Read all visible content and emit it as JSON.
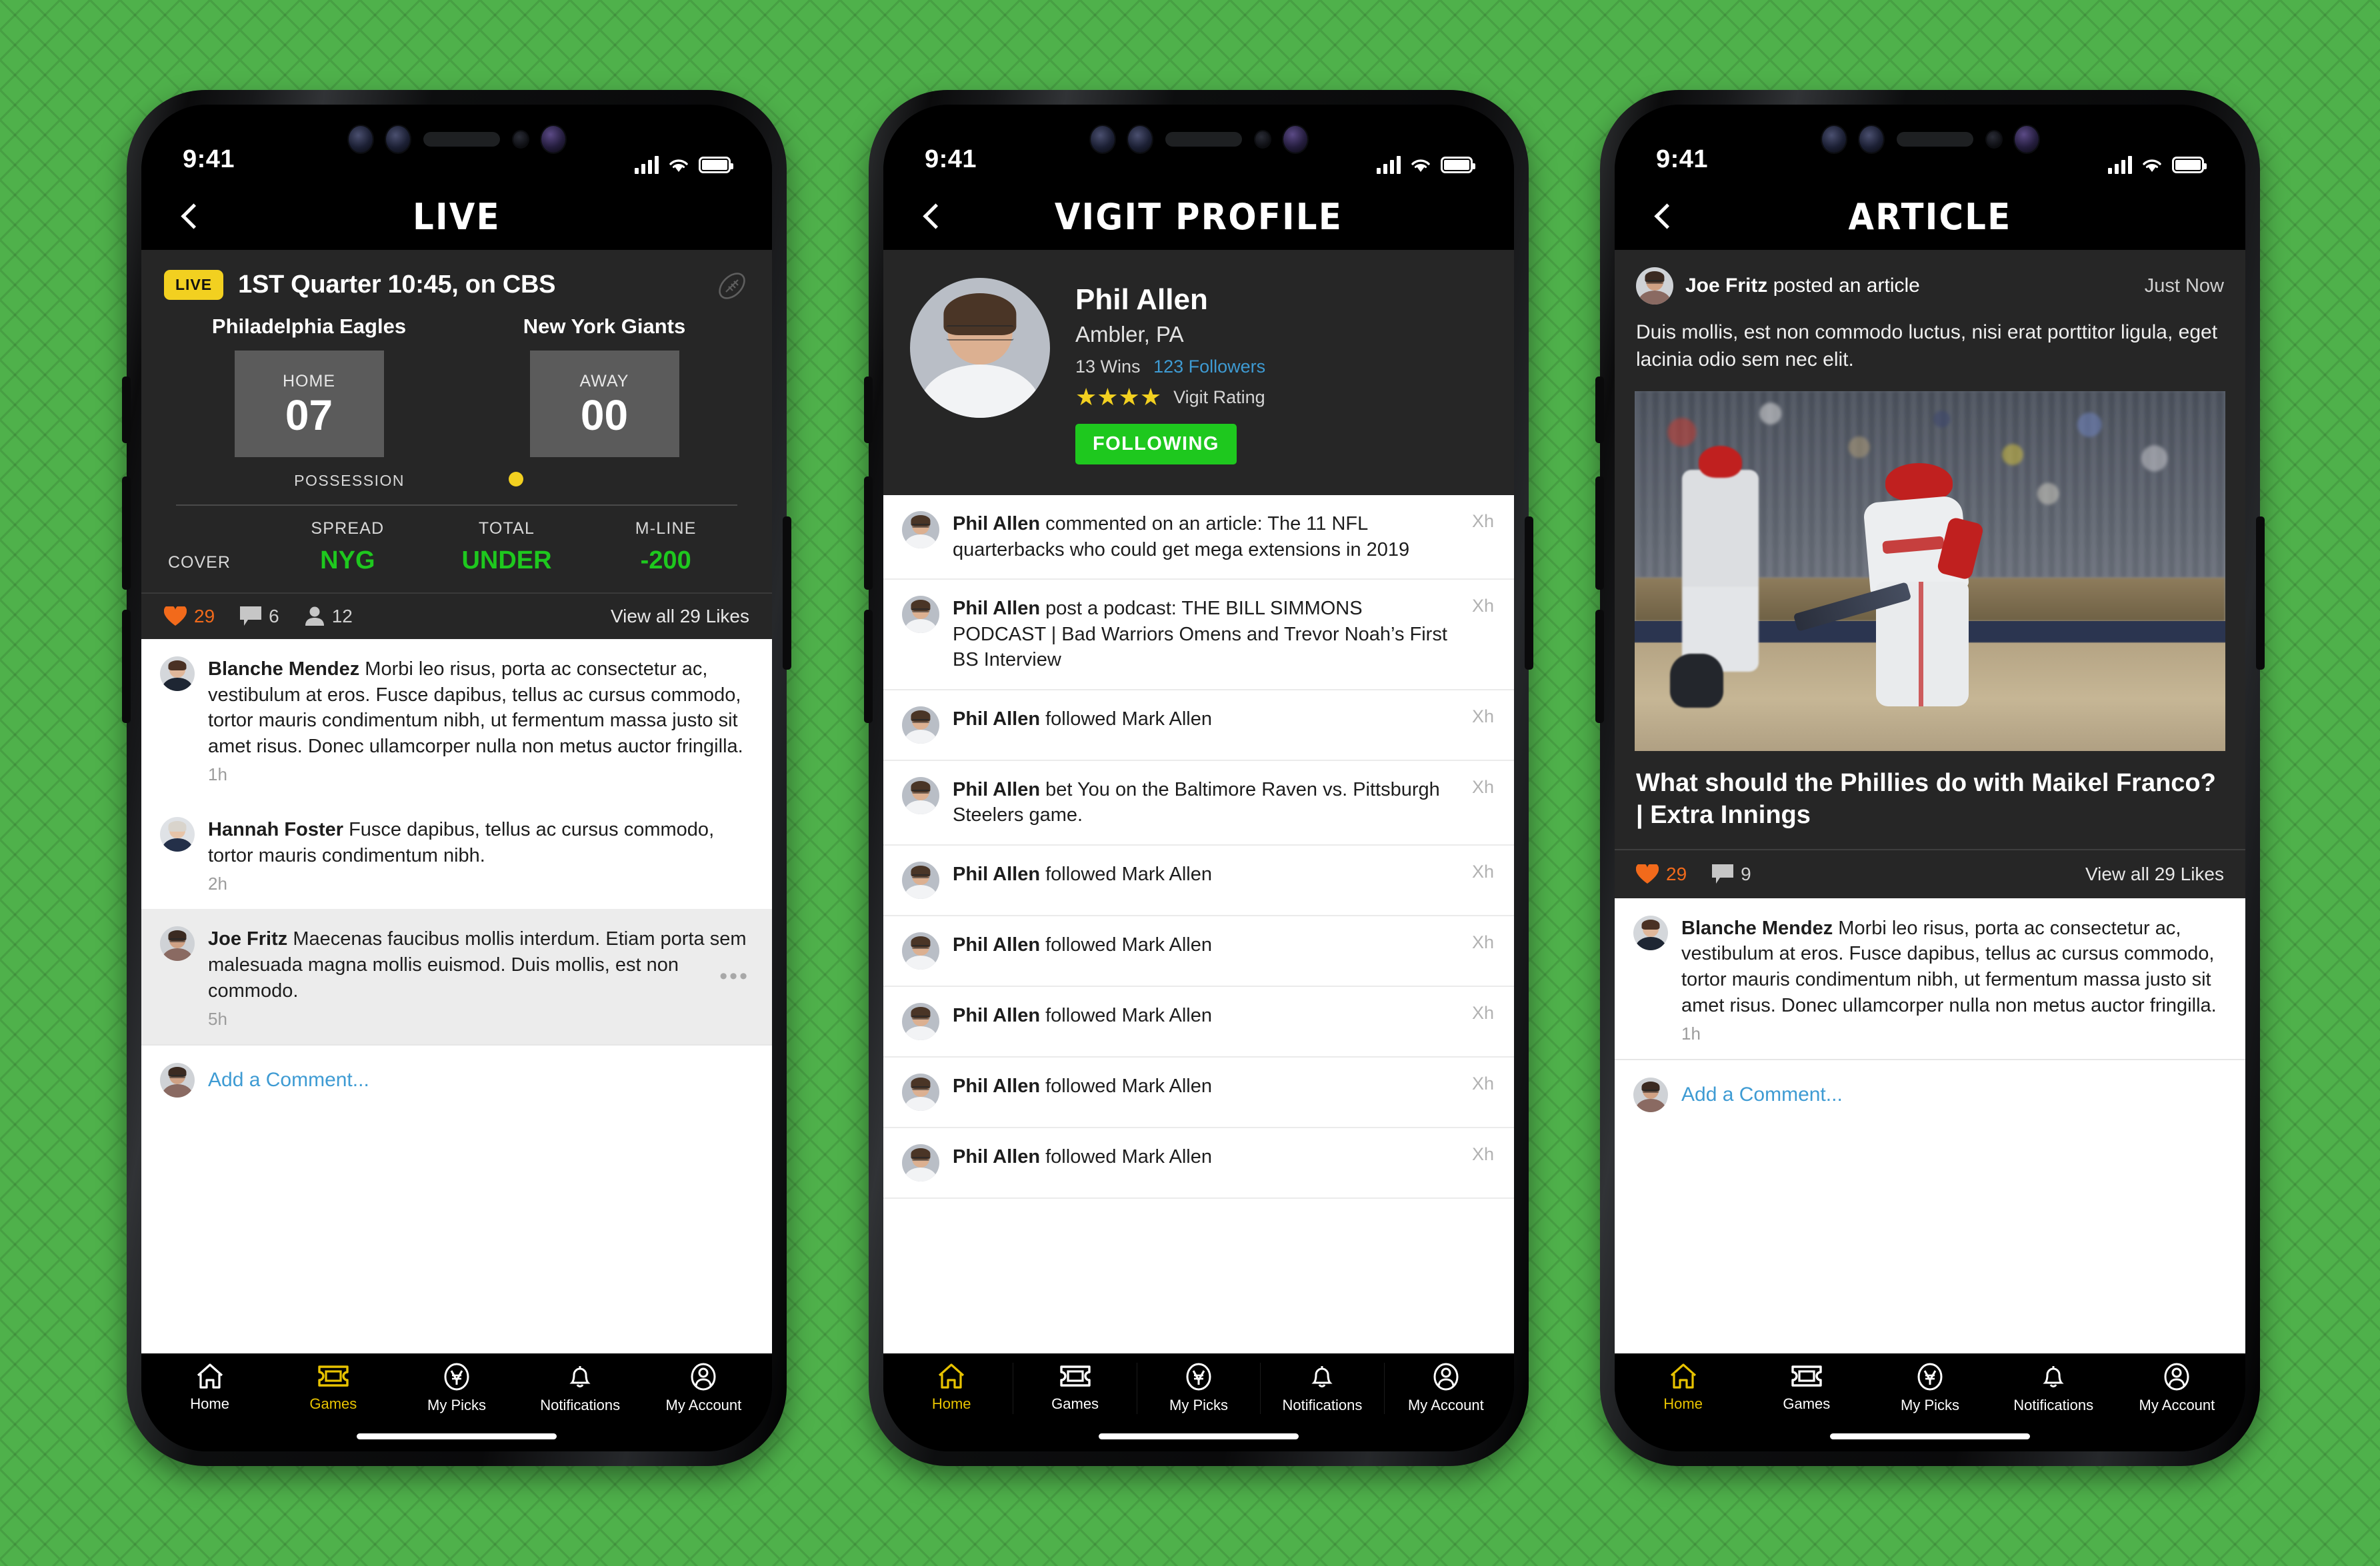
{
  "background": {
    "color": "#4fb14b",
    "pattern": "x-cross-tile"
  },
  "status_bar": {
    "time": "9:41",
    "signal_icon": "cellular-bars-icon",
    "wifi_icon": "wifi-icon",
    "battery_icon": "battery-icon"
  },
  "colors": {
    "accent_yellow": "#f2d020",
    "accent_green": "#1ec81e",
    "accent_orange": "#f26a1b",
    "link_blue": "#3e9bd3",
    "tab_active": "#e8c300",
    "panel_dark": "#262626"
  },
  "tabs": [
    {
      "label": "Home",
      "icon": "home-icon"
    },
    {
      "label": "Games",
      "icon": "ticket-icon"
    },
    {
      "label": "My Picks",
      "icon": "currency-oval-icon"
    },
    {
      "label": "Notifications",
      "icon": "bell-icon"
    },
    {
      "label": "My Account",
      "icon": "account-circle-icon"
    }
  ],
  "phone1": {
    "nav_title": "LIVE",
    "back_icon": "chevron-left-icon",
    "scoreboard": {
      "live_badge": "LIVE",
      "status_text": "1ST Quarter 10:45, on CBS",
      "sport_icon": "football-icon",
      "home": {
        "team": "Philadelphia Eagles",
        "side": "HOME",
        "score": "07"
      },
      "away": {
        "team": "New York Giants",
        "side": "AWAY",
        "score": "00"
      },
      "possession_label": "POSSESSION",
      "possession_team": "away",
      "odds": {
        "cover_label": "COVER",
        "columns": [
          {
            "label": "SPREAD",
            "value": "NYG"
          },
          {
            "label": "TOTAL",
            "value": "UNDER"
          },
          {
            "label": "M-LINE",
            "value": "-200"
          }
        ]
      }
    },
    "engagement": {
      "likes": "29",
      "comments": "6",
      "people": "12",
      "view_all": "View all 29 Likes",
      "like_icon": "heart-icon",
      "comment_icon": "speech-bubble-icon",
      "people_icon": "person-icon"
    },
    "comments": [
      {
        "author": "Blanche Mendez",
        "text": "Morbi leo risus, porta ac consectetur ac, vestibulum at eros. Fusce dapibus, tellus ac cursus commodo, tortor mauris condimentum nibh, ut fermentum massa justo sit amet risus. Donec ullamcorper nulla non metus auctor fringilla.",
        "time": "1h",
        "avatar": "av-blanche",
        "highlight": false,
        "more_icon": ""
      },
      {
        "author": "Hannah Foster",
        "text": "Fusce dapibus, tellus ac cursus commodo, tortor mauris condimentum nibh.",
        "time": "2h",
        "avatar": "av-hannah",
        "highlight": false,
        "more_icon": ""
      },
      {
        "author": "Joe Fritz",
        "text": "Maecenas faucibus mollis interdum. Etiam porta sem malesuada magna mollis euismod. Duis mollis, est non commodo.",
        "time": "5h",
        "avatar": "av-joe",
        "highlight": true,
        "more_icon": "•••"
      }
    ],
    "add_comment": {
      "placeholder": "Add a Comment...",
      "avatar": "av-joe"
    },
    "active_tab": "Games"
  },
  "phone2": {
    "nav_title": "VIGIT PROFILE",
    "back_icon": "chevron-left-icon",
    "profile": {
      "name": "Phil Allen",
      "location": "Ambler, PA",
      "wins": "13 Wins",
      "followers": "123 Followers",
      "stars": "★★★★",
      "rating_label": "Vigit Rating",
      "follow_button": "FOLLOWING"
    },
    "feed": [
      {
        "actor": "Phil Allen",
        "action": " commented on an article: The 11 NFL quarterbacks who could get mega extensions in 2019",
        "time": "Xh"
      },
      {
        "actor": "Phil Allen",
        "action": " post a podcast: THE BILL SIMMONS PODCAST | Bad Warriors Omens and Trevor Noah’s First BS Interview",
        "time": "Xh"
      },
      {
        "actor": "Phil Allen",
        "action": " followed Mark Allen",
        "time": "Xh"
      },
      {
        "actor": "Phil Allen",
        "action": " bet You on the Baltimore Raven vs. Pittsburgh Steelers game.",
        "time": "Xh"
      },
      {
        "actor": "Phil Allen",
        "action": " followed Mark Allen",
        "time": "Xh"
      },
      {
        "actor": "Phil Allen",
        "action": " followed Mark Allen",
        "time": "Xh"
      },
      {
        "actor": "Phil Allen",
        "action": " followed Mark Allen",
        "time": "Xh"
      },
      {
        "actor": "Phil Allen",
        "action": " followed Mark Allen",
        "time": "Xh"
      },
      {
        "actor": "Phil Allen",
        "action": " followed Mark Allen",
        "time": "Xh"
      }
    ],
    "active_tab": "Home"
  },
  "phone3": {
    "nav_title": "ARTICLE",
    "back_icon": "chevron-left-icon",
    "post": {
      "author": "Joe Fritz",
      "action": " posted an article",
      "time": "Just Now",
      "lead": "Duis mollis, est non commodo luctus, nisi erat porttitor ligula, eget lacinia odio sem nec elit.",
      "image_alt": "phillies-batter-photo",
      "title": "What should the Phillies do with Maikel Franco? | Extra Innings"
    },
    "engagement": {
      "likes": "29",
      "comments": "9",
      "view_all": "View all 29 Likes",
      "like_icon": "heart-icon",
      "comment_icon": "speech-bubble-icon"
    },
    "comments": [
      {
        "author": "Blanche Mendez",
        "text": "Morbi leo risus, porta ac consectetur ac, vestibulum at eros. Fusce dapibus, tellus ac cursus commodo, tortor mauris condimentum nibh, ut fermentum massa justo sit amet risus. Donec ullamcorper nulla non metus auctor fringilla.",
        "time": "1h",
        "avatar": "av-blanche"
      }
    ],
    "add_comment": {
      "placeholder": "Add a Comment...",
      "avatar": "av-joe"
    },
    "active_tab": "Home"
  }
}
